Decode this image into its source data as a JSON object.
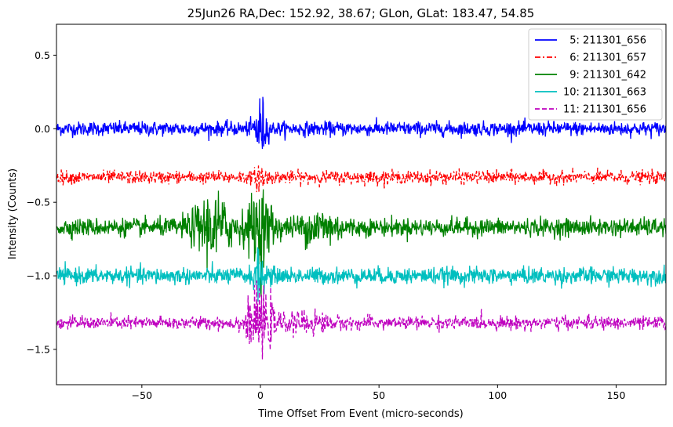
{
  "chart_data": {
    "type": "line",
    "title": "25Jun26 RA,Dec:  152.92,  38.67; GLon, GLat:  183.47,  54.85",
    "xlabel": "Time Offset From Event (micro-seconds)",
    "ylabel": "Intensity (Counts)",
    "xlim": [
      -86,
      171
    ],
    "ylim": [
      -1.74,
      0.71
    ],
    "xticks": [
      -50,
      0,
      50,
      100,
      150
    ],
    "xtick_labels": [
      "−50",
      "0",
      "50",
      "100",
      "150"
    ],
    "yticks": [
      0.5,
      0.0,
      -0.5,
      -1.0,
      -1.5
    ],
    "ytick_labels": [
      "0.5",
      "0.0",
      "−0.5",
      "−1.0",
      "−1.5"
    ],
    "grid": false,
    "legend_position": "top-right",
    "series": [
      {
        "name": "  5: 211301_656",
        "color": "#0000ff",
        "dash": "solid",
        "baseline": 0.0,
        "noise": 0.024,
        "spikes": [
          {
            "x": 0,
            "width": 1.8,
            "amp": 0.12
          }
        ]
      },
      {
        "name": "  6: 211301_657",
        "color": "#ff0000",
        "dash": "dashdot",
        "baseline": -0.33,
        "noise": 0.022,
        "spikes": [
          {
            "x": 0,
            "width": 1.5,
            "amp": 0.05
          }
        ]
      },
      {
        "name": "  9: 211301_642",
        "color": "#008000",
        "dash": "solid",
        "baseline": -0.67,
        "noise": 0.03,
        "spikes": [
          {
            "x": -20,
            "width": 6,
            "amp": 0.12
          },
          {
            "x": 0,
            "width": 4,
            "amp": 0.14
          },
          {
            "x": 25,
            "width": 6,
            "amp": 0.06
          }
        ]
      },
      {
        "name": "10: 211301_663",
        "color": "#00bfbf",
        "dash": "solid",
        "baseline": -1.0,
        "noise": 0.028,
        "spikes": [
          {
            "x": 0,
            "width": 2,
            "amp": 0.08
          }
        ]
      },
      {
        "name": "11: 211301_656",
        "color": "#bf00bf",
        "dash": "dashed",
        "baseline": -1.32,
        "noise": 0.022,
        "spikes": [
          {
            "x": 0,
            "width": 4,
            "amp": 0.12
          },
          {
            "x": 20,
            "width": 6,
            "amp": 0.03
          }
        ]
      }
    ]
  }
}
